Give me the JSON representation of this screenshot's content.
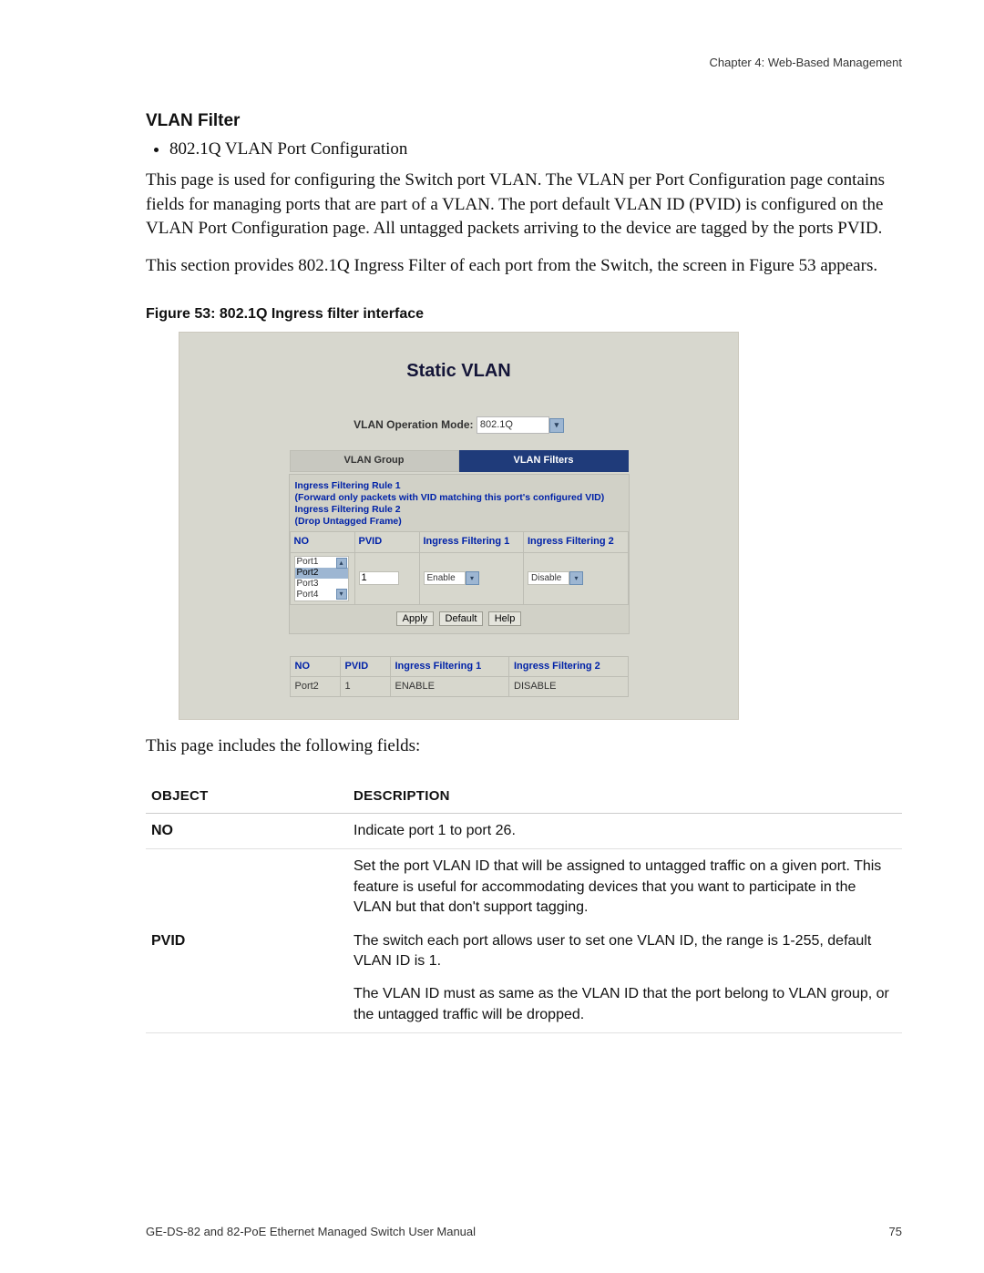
{
  "header": {
    "chapter_label": "Chapter 4: Web-Based Management"
  },
  "section": {
    "title": "VLAN Filter",
    "bullet": "802.1Q VLAN Port Configuration",
    "para1": "This page is used for configuring the Switch port VLAN. The VLAN per Port Configuration page contains fields for managing ports that are part of a VLAN. The port default VLAN ID (PVID) is configured on the VLAN Port Configuration page. All untagged packets arriving to the device are tagged by the ports PVID.",
    "para2": "This section provides 802.1Q Ingress Filter of each port from the Switch, the screen in Figure 53 appears.",
    "figure_caption": "Figure 53: 802.1Q Ingress filter interface",
    "after_figure": "This page includes the following fields:"
  },
  "screenshot": {
    "title": "Static VLAN",
    "op_mode_label": "VLAN Operation Mode:",
    "op_mode_value": "802.1Q",
    "tab_left": "VLAN Group",
    "tab_right": "VLAN Filters",
    "rule1_title": "Ingress Filtering Rule 1",
    "rule1_desc": "(Forward only packets with VID matching this port's configured VID)",
    "rule2_title": "Ingress Filtering Rule 2",
    "rule2_desc": "(Drop Untagged Frame)",
    "col_no": "NO",
    "col_pvid": "PVID",
    "col_if1": "Ingress Filtering 1",
    "col_if2": "Ingress Filtering 2",
    "port1": "Port1",
    "port2": "Port2",
    "port3": "Port3",
    "port4": "Port4",
    "pvid_value": "1",
    "if1_value": "Enable",
    "if2_value": "Disable",
    "btn_apply": "Apply",
    "btn_default": "Default",
    "btn_help": "Help",
    "result_port": "Port2",
    "result_pvid": "1",
    "result_if1": "ENABLE",
    "result_if2": "DISABLE"
  },
  "obj_table": {
    "header_obj": "OBJECT",
    "header_desc": "DESCRIPTION",
    "rows": [
      {
        "obj": "NO",
        "desc1": "Indicate port 1 to port 26."
      },
      {
        "obj": "PVID",
        "desc1": "Set the port VLAN ID that will be assigned to untagged traffic on a given port. This feature is useful for accommodating devices that you want to participate in the VLAN but that don't support tagging.",
        "desc2": "The switch each port allows user to set one VLAN ID, the range is 1-255, default VLAN ID is 1.",
        "desc3": "The VLAN ID must as same as the VLAN ID that the port belong to VLAN group, or the untagged traffic will be dropped."
      }
    ]
  },
  "footer": {
    "manual_title": "GE-DS-82 and 82-PoE Ethernet Managed Switch User Manual",
    "page_number": "75"
  }
}
